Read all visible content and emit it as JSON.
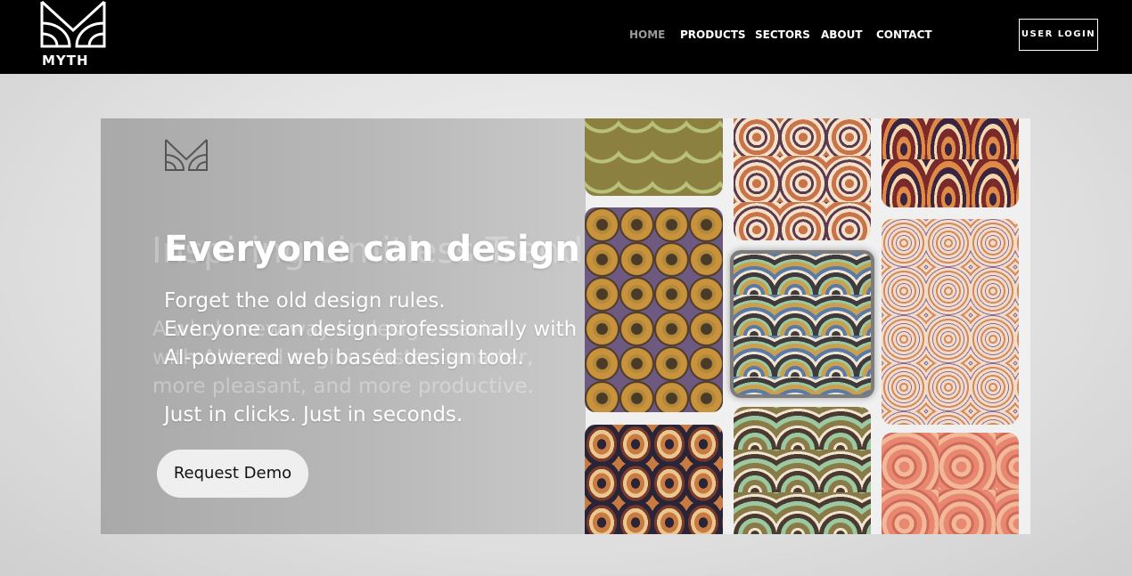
{
  "header": {
    "logo_text": "MYTH",
    "nav": [
      {
        "label": "HOME",
        "active": true
      },
      {
        "label": "PRODUCTS",
        "active": false
      },
      {
        "label": "SECTORS",
        "active": false
      },
      {
        "label": "ABOUT",
        "active": false
      },
      {
        "label": "CONTACT",
        "active": false
      }
    ],
    "login_label": "USER LOGIN"
  },
  "hero": {
    "title": "Everyone can design",
    "lines": [
      "Forget the old design rules.",
      "Everyone can design professionally with",
      "AI-powered web based design tool.",
      "Just in clicks. Just in seconds."
    ],
    "cta_label": "Request Demo"
  },
  "colors": {
    "header_bg": "#000000",
    "nav_active": "#9a9a9a",
    "nav_text": "#ffffff",
    "hero_panel": "#b3b3b3",
    "cta_bg": "#efefef"
  },
  "tiles": [
    {
      "pattern": "olive-scallop",
      "colors": [
        "#8c8040",
        "#b8c27a",
        "#6f6a32"
      ]
    },
    {
      "pattern": "ornate-rings",
      "colors": [
        "#c8734a",
        "#f3e1c8",
        "#5a3a52"
      ]
    },
    {
      "pattern": "flame-ornament",
      "colors": [
        "#7a2a2a",
        "#e08a48",
        "#3a2440"
      ]
    },
    {
      "pattern": "eye-circles",
      "colors": [
        "#6e5a80",
        "#c9923c",
        "#4a3a28"
      ]
    },
    {
      "pattern": "peacock-scale",
      "colors": [
        "#3e3a3e",
        "#c8a050",
        "#5a7aa8"
      ]
    },
    {
      "pattern": "swirl-rings",
      "colors": [
        "#f0dcc8",
        "#d48a5a",
        "#8a6a9a"
      ]
    },
    {
      "pattern": "kaleido",
      "colors": [
        "#c87a40",
        "#2a2438",
        "#e8c890"
      ]
    },
    {
      "pattern": "stripe-rings",
      "colors": [
        "#8a7a48",
        "#9ac8a0",
        "#4a3a30"
      ]
    },
    {
      "pattern": "pink-swirl",
      "colors": [
        "#e88870",
        "#f2b89a",
        "#d06a5a"
      ]
    }
  ]
}
